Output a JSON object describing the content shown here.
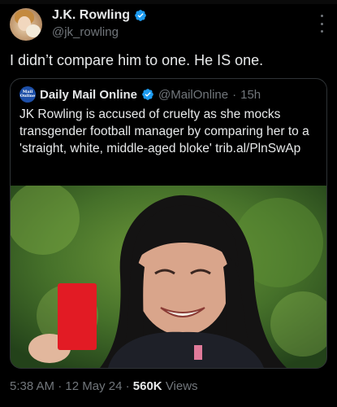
{
  "tweet": {
    "author": {
      "display_name": "J.K. Rowling",
      "handle": "@jk_rowling",
      "verified_icon": "verified-badge-icon"
    },
    "text": "I didn’t compare him to one. He IS one.",
    "more_icon": "more-options-icon"
  },
  "quoted_tweet": {
    "author": {
      "display_name": "Daily Mail Online",
      "handle": "@MailOnline",
      "avatar_lines": [
        "Mail",
        "Online"
      ],
      "verified_icon": "verified-badge-icon"
    },
    "separator": "·",
    "time": "15h",
    "text": "JK Rowling is accused of cruelty as she mocks transgender football manager by comparing her to a 'straight, white, middle-aged bloke' trib.al/PlnSwAp",
    "image_icon": "news-photo"
  },
  "meta": {
    "time": "5:38 AM",
    "dot": "·",
    "date": "12 May 24",
    "views_count": "560K",
    "views_label": "Views"
  },
  "colors": {
    "background": "#000000",
    "text": "#e7e9ea",
    "secondary": "#71767b",
    "verified": "#1d9bf0",
    "border": "#2f3336"
  }
}
